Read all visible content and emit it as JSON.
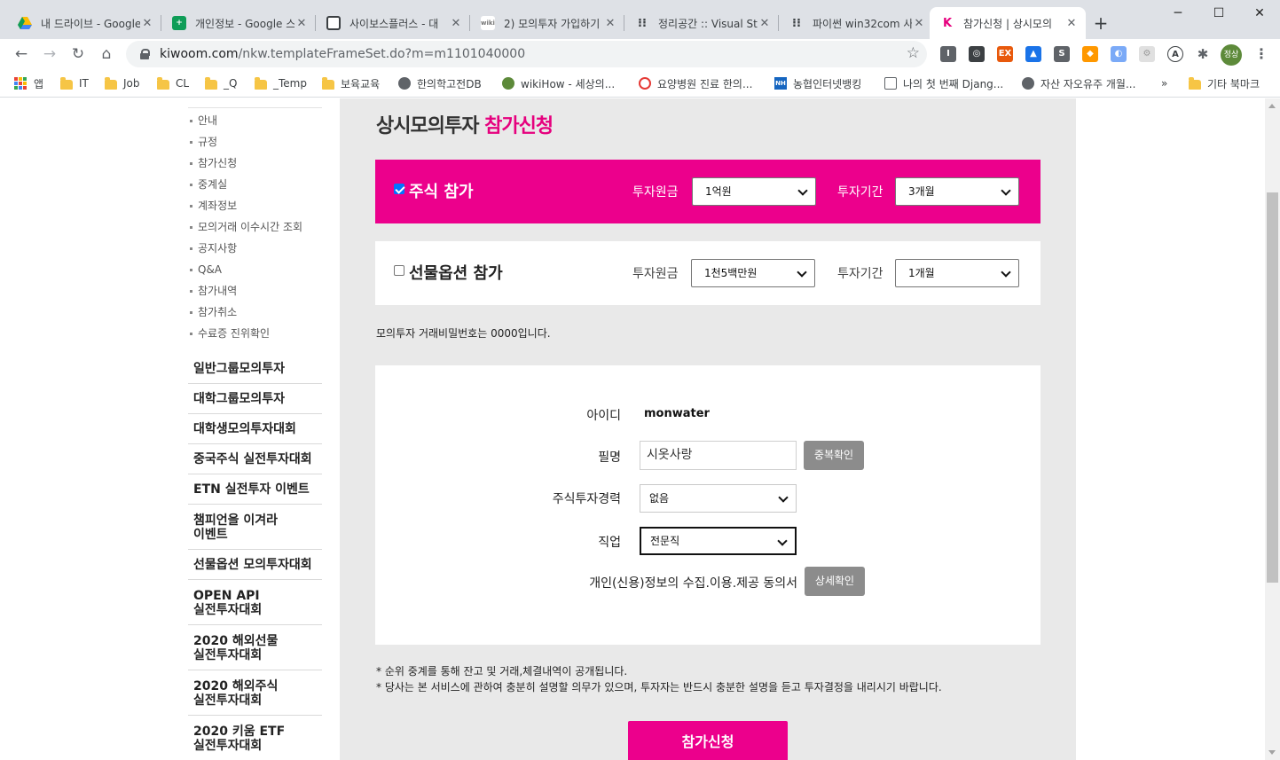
{
  "browser": {
    "tabs": [
      {
        "label": "내 드라이브 - Google",
        "favicon": "google-drive-icon",
        "color": "#fbbc04"
      },
      {
        "label": "개인정보 - Google 스",
        "favicon": "google-sheets-icon",
        "color": "#0f9d58"
      },
      {
        "label": "사이보스플러스 - 대",
        "favicon": "cybos-icon",
        "color": "#3c4043"
      },
      {
        "label": "2) 모의투자 가입하기",
        "favicon": "wikidocs-icon",
        "color": "#9e9e9e"
      },
      {
        "label": "정리공간 :: Visual St",
        "favicon": "tistory-icon",
        "color": "#3c4043"
      },
      {
        "label": "파이썬 win32com 사",
        "favicon": "tistory-icon",
        "color": "#3c4043"
      },
      {
        "label": "참가신청 | 상시모의",
        "favicon": "kiwoom-icon",
        "color": "#e6007e"
      }
    ],
    "new_tab": "+",
    "window_controls": {
      "minimize": "─",
      "maximize": "☐",
      "close": "✕"
    },
    "url_host": "kiwoom.com",
    "url_path": "/nkw.templateFrameSet.do?m=m1101040000",
    "bookmarks": [
      {
        "label": "앱",
        "icon": "apps-icon"
      },
      {
        "label": "IT",
        "icon": "folder-icon"
      },
      {
        "label": "Job",
        "icon": "folder-icon"
      },
      {
        "label": "CL",
        "icon": "folder-icon"
      },
      {
        "label": "_Q",
        "icon": "folder-icon"
      },
      {
        "label": "_Temp",
        "icon": "folder-icon"
      },
      {
        "label": "보육교육",
        "icon": "folder-icon"
      },
      {
        "label": "한의학고전DB",
        "icon": "globe-icon"
      },
      {
        "label": "wikiHow - 세상의...",
        "icon": "wikihow-icon"
      },
      {
        "label": "요양병원 진료 한의...",
        "icon": "site-icon"
      },
      {
        "label": "농협인터넷뱅킹",
        "icon": "nh-icon"
      },
      {
        "label": "나의 첫 번째 Djang...",
        "icon": "book-icon"
      },
      {
        "label": "자산 자오유주 개월...",
        "icon": "globe-icon"
      }
    ],
    "bookmarks_more": "»",
    "other_bookmarks": "기타 북마크",
    "profile_label": "정상"
  },
  "sidebar": {
    "submenu": [
      "안내",
      "규정",
      "참가신청",
      "중계실",
      "계좌정보",
      "모의거래 이수시간 조회",
      "공지사항",
      "Q&A",
      "참가내역",
      "참가취소",
      "수료증 진위확인"
    ],
    "mainmenu": [
      {
        "line1": "일반그룹모의투자",
        "line2": ""
      },
      {
        "line1": "대학그룹모의투자",
        "line2": ""
      },
      {
        "line1": "대학생모의투자대회",
        "line2": ""
      },
      {
        "line1": "중국주식 실전투자대회",
        "line2": ""
      },
      {
        "line1": "ETN 실전투자 이벤트",
        "line2": ""
      },
      {
        "line1": "챔피언을 이겨라",
        "line2": "이벤트"
      },
      {
        "line1": "선물옵션 모의투자대회",
        "line2": ""
      },
      {
        "line1": "OPEN API",
        "line2": "실전투자대회"
      },
      {
        "line1": "2020 해외선물",
        "line2": "실전투자대회"
      },
      {
        "line1": "2020 해외주식",
        "line2": "실전투자대회"
      },
      {
        "line1": "2020 키움 ETF",
        "line2": "실전투자대회"
      }
    ]
  },
  "main": {
    "title_prefix": "상시모의투자",
    "title_accent": "참가신청",
    "stock": {
      "checked": true,
      "label": "주식 참가",
      "principal_label": "투자원금",
      "principal_value": "1억원",
      "period_label": "투자기간",
      "period_value": "3개월"
    },
    "futures": {
      "checked": false,
      "label": "선물옵션 참가",
      "principal_label": "투자원금",
      "principal_value": "1천5백만원",
      "period_label": "투자기간",
      "period_value": "1개월"
    },
    "password_note": "모의투자 거래비밀번호는 0000입니다.",
    "form": {
      "id_label": "아이디",
      "id_value": "monwater",
      "nickname_label": "필명",
      "nickname_value": "시옷사랑",
      "dup_check_button": "중복확인",
      "experience_label": "주식투자경력",
      "experience_value": "없음",
      "job_label": "직업",
      "job_value": "전문직",
      "consent_label": "개인(신용)정보의 수집.이용.제공 동의서",
      "consent_button": "상세확인"
    },
    "notes": [
      "* 순위 중계를 통해 잔고 및 거래,체결내역이 공개됩니다.",
      "* 당사는 본 서비스에 관하여 충분히 설명할 의무가 있으며, 투자자는 반드시 충분한 설명을 듣고 투자결정을 내리시기 바랍니다."
    ],
    "submit_label": "참가신청"
  },
  "colors": {
    "brand_pink": "#ec008c",
    "title_accent": "#e6007e",
    "panel_gray": "#e9e9e9",
    "button_gray": "#8c8c8c"
  }
}
